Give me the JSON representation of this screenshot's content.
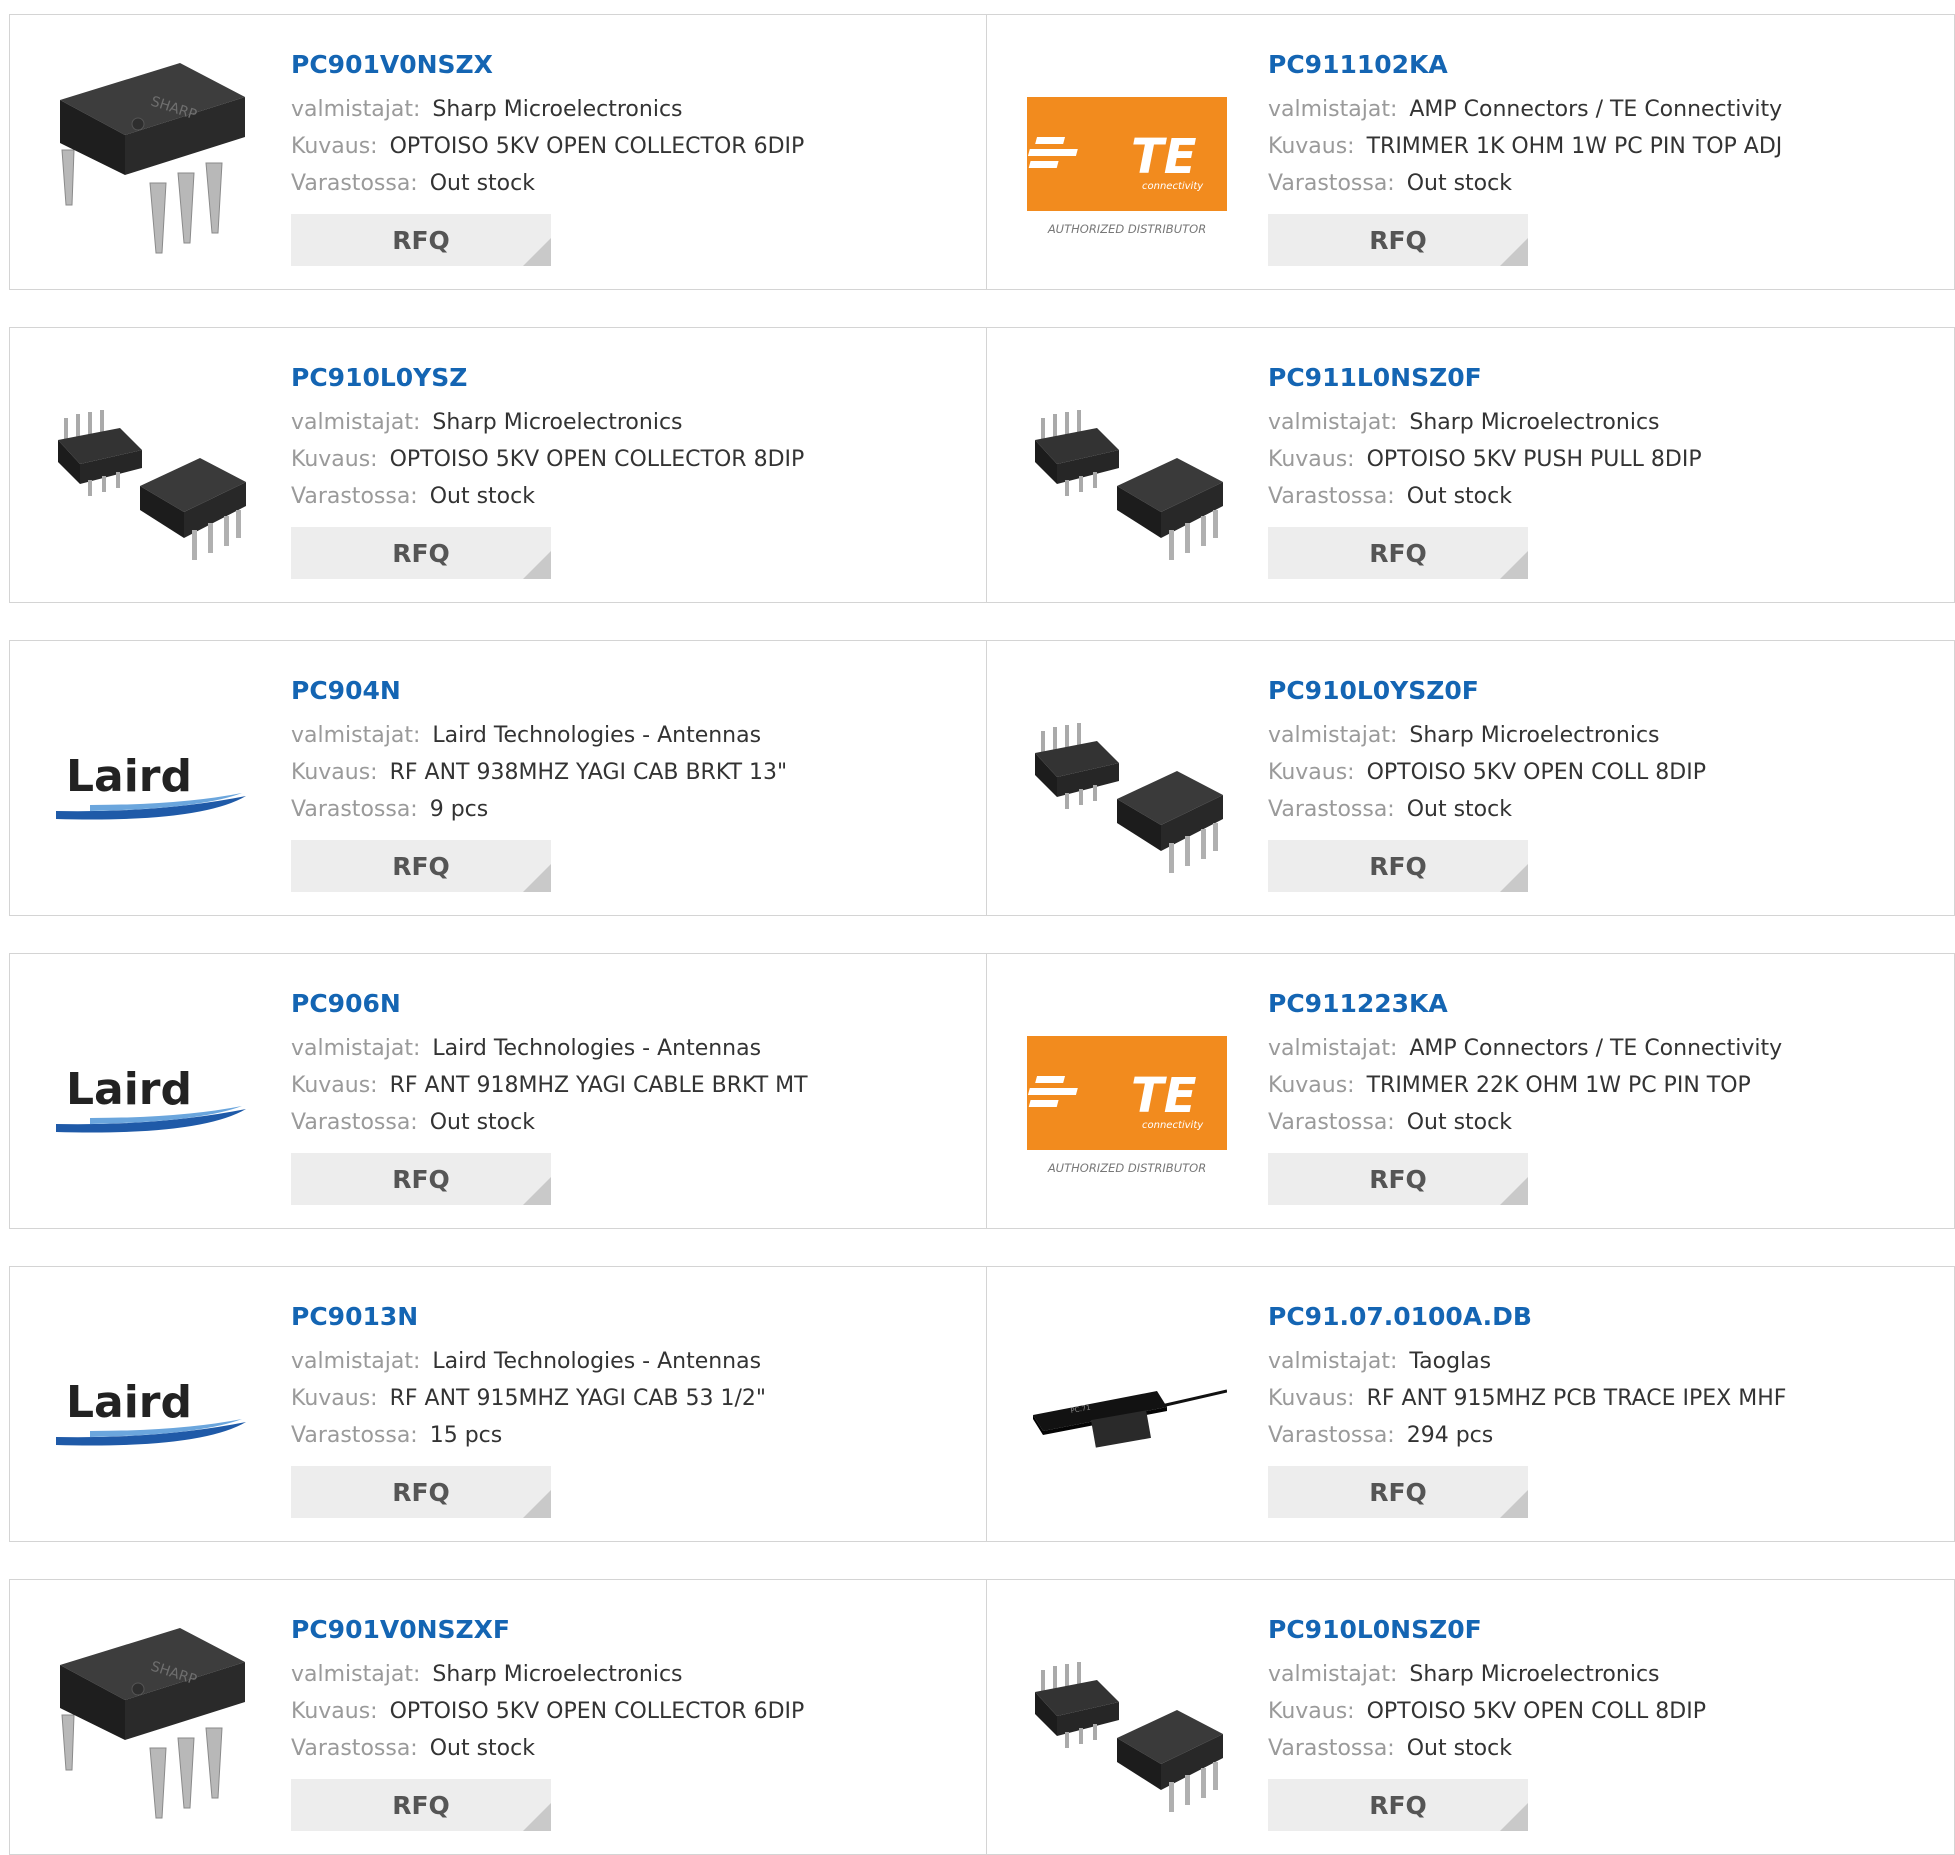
{
  "labels": {
    "manufacturer": "valmistajat:",
    "description": "Kuvaus:",
    "stock": "Varastossa:",
    "rfq": "RFQ"
  },
  "logo_text": {
    "te_connectivity": "connectivity",
    "te_authorized": "AUTHORIZED DISTRIBUTOR",
    "laird": "Laird",
    "sharp": "SHARP"
  },
  "colors": {
    "link": "#1465b3",
    "te_orange": "#f28b1e",
    "laird_blue": "#1f5aa8"
  },
  "products": [
    {
      "part": "PC901V0NSZX",
      "manufacturer": "Sharp Microelectronics",
      "description": "OPTOISO 5KV OPEN COLLECTOR 6DIP",
      "stock": "Out stock",
      "image": "sharp-6dip-icon"
    },
    {
      "part": "PC911102KA",
      "manufacturer": "AMP Connectors / TE Connectivity",
      "description": "TRIMMER 1K OHM 1W PC PIN TOP ADJ",
      "stock": "Out stock",
      "image": "te-connectivity-logo"
    },
    {
      "part": "PC910L0YSZ",
      "manufacturer": "Sharp Microelectronics",
      "description": "OPTOISO 5KV OPEN COLLECTOR 8DIP",
      "stock": "Out stock",
      "image": "dip8-pair-icon"
    },
    {
      "part": "PC911L0NSZ0F",
      "manufacturer": "Sharp Microelectronics",
      "description": "OPTOISO 5KV PUSH PULL 8DIP",
      "stock": "Out stock",
      "image": "dip8-pair-icon"
    },
    {
      "part": "PC904N",
      "manufacturer": "Laird Technologies - Antennas",
      "description": "RF ANT 938MHZ YAGI CAB BRKT 13\"",
      "stock": "9 pcs",
      "image": "laird-logo"
    },
    {
      "part": "PC910L0YSZ0F",
      "manufacturer": "Sharp Microelectronics",
      "description": "OPTOISO 5KV OPEN COLL 8DIP",
      "stock": "Out stock",
      "image": "dip8-pair-icon"
    },
    {
      "part": "PC906N",
      "manufacturer": "Laird Technologies - Antennas",
      "description": "RF ANT 918MHZ YAGI CABLE BRKT MT",
      "stock": "Out stock",
      "image": "laird-logo"
    },
    {
      "part": "PC911223KA",
      "manufacturer": "AMP Connectors / TE Connectivity",
      "description": "TRIMMER 22K OHM 1W PC PIN TOP",
      "stock": "Out stock",
      "image": "te-connectivity-logo"
    },
    {
      "part": "PC9013N",
      "manufacturer": "Laird Technologies - Antennas",
      "description": "RF ANT 915MHZ YAGI CAB 53 1/2\"",
      "stock": "15 pcs",
      "image": "laird-logo"
    },
    {
      "part": "PC91.07.0100A.DB",
      "manufacturer": "Taoglas",
      "description": "RF ANT 915MHZ PCB TRACE IPEX MHF",
      "stock": "294 pcs",
      "image": "pcb-antenna-icon"
    },
    {
      "part": "PC901V0NSZXF",
      "manufacturer": "Sharp Microelectronics",
      "description": "OPTOISO 5KV OPEN COLLECTOR 6DIP",
      "stock": "Out stock",
      "image": "sharp-6dip-icon"
    },
    {
      "part": "PC910L0NSZ0F",
      "manufacturer": "Sharp Microelectronics",
      "description": "OPTOISO 5KV OPEN COLL 8DIP",
      "stock": "Out stock",
      "image": "dip8-pair-icon"
    }
  ]
}
